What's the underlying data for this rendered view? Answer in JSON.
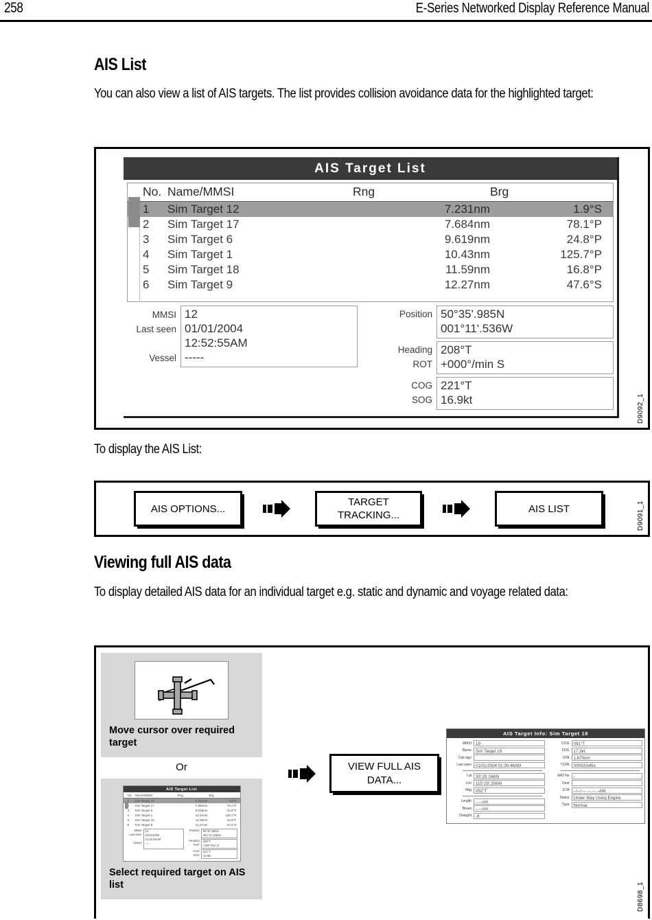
{
  "header": {
    "page_number": "258",
    "manual_title": "E-Series Networked Display Reference Manual"
  },
  "sections": {
    "ais_list": {
      "heading": "AIS List",
      "intro": "You can also view a list of AIS targets. The list provides collision avoidance data for the highlighted target:",
      "display_line": "To display the AIS List:"
    },
    "viewing_full": {
      "heading": "Viewing full AIS data",
      "intro": "To display detailed AIS data for an individual target e.g. static and dynamic and voyage related data:"
    }
  },
  "ais_list_screen": {
    "title": "AIS Target List",
    "columns": [
      "No.",
      "Name/MMSI",
      "Rng",
      "Brg"
    ],
    "rows": [
      {
        "no": "1",
        "name": "Sim Target 12",
        "rng": "7.231nm",
        "brg": "1.9°S",
        "selected": true
      },
      {
        "no": "2",
        "name": "Sim Target 17",
        "rng": "7.684nm",
        "brg": "78.1°P",
        "selected": false
      },
      {
        "no": "3",
        "name": "Sim Target 6",
        "rng": "9.619nm",
        "brg": "24.8°P",
        "selected": false
      },
      {
        "no": "4",
        "name": "Sim Target 1",
        "rng": "10.43nm",
        "brg": "125.7°P",
        "selected": false
      },
      {
        "no": "5",
        "name": "Sim Target 18",
        "rng": "11.59nm",
        "brg": "16.8°P",
        "selected": false
      },
      {
        "no": "6",
        "name": "Sim Target 9",
        "rng": "12.27nm",
        "brg": "47.6°S",
        "selected": false
      }
    ],
    "detail": {
      "labels_left": [
        "MMSI",
        "Last seen",
        "Vessel"
      ],
      "vessel_lines": [
        "12",
        "01/01/2004",
        "12:52:55AM",
        "-----"
      ],
      "position_label": "Position",
      "position_lines": [
        "50°35'.985N",
        "001°11'.536W"
      ],
      "heading_label": "Heading",
      "rot_label": "ROT",
      "heading_lines": [
        "208°T",
        "+000°/min S"
      ],
      "cog_label": "COG",
      "sog_label": "SOG",
      "cog_lines": [
        "221°T",
        "16.9kt"
      ]
    },
    "figure_ref": "D9092_1"
  },
  "flow_diagram": {
    "steps": [
      "AIS OPTIONS...",
      "TARGET TRACKING...",
      "AIS LIST"
    ],
    "figure_ref": "D9091_1"
  },
  "view_data_diagram": {
    "cursor_caption": "Move cursor over required target",
    "or_label": "Or",
    "list_caption": "Select required target on AIS list",
    "button_label": "VIEW FULL AIS DATA...",
    "figure_ref": "D8698_1",
    "mini_list": {
      "title": "AIS Target List",
      "columns": [
        "No.",
        "Name/MMSI",
        "Rng",
        "Brg"
      ],
      "rows": [
        {
          "no": "1",
          "name": "Sim Target 12",
          "rng": "7.231nm",
          "brg": "1.9°S",
          "selected": true
        },
        {
          "no": "2",
          "name": "Sim Target 17",
          "rng": "7.684nm",
          "brg": "78.1°P",
          "selected": false
        },
        {
          "no": "3",
          "name": "Sim Target 6",
          "rng": "9.619nm",
          "brg": "24.8°P",
          "selected": false
        },
        {
          "no": "4",
          "name": "Sim Target 1",
          "rng": "10.43nm",
          "brg": "125.7°P",
          "selected": false
        },
        {
          "no": "5",
          "name": "Sim Target 18",
          "rng": "11.59nm",
          "brg": "16.8°P",
          "selected": false
        },
        {
          "no": "6",
          "name": "Sim Target 9",
          "rng": "12.27nm",
          "brg": "47.6°S",
          "selected": false
        }
      ],
      "detail": {
        "mmsi_label": "MMSI",
        "last_seen_label": "Last seen",
        "vessel_label": "Vessel",
        "vessel_lines": [
          "12",
          "01/01/2004",
          "12:52:55AM",
          "-----"
        ],
        "position_label": "Position",
        "position_lines": [
          "50°35'.985N",
          "001°11'.536W"
        ],
        "heading_label": "Heading",
        "rot_label": "ROT",
        "heading_lines": [
          "208°T",
          "+000°/min S"
        ],
        "cog_label": "COG",
        "sog_label": "SOG",
        "cog_lines": [
          "221°T",
          "16.9kt"
        ]
      }
    },
    "target_info": {
      "title": "AIS Target Info: Sim Target 19",
      "left_fields": [
        {
          "label": "MMSI",
          "value": "19"
        },
        {
          "label": "Name",
          "value": "Sim Target 19"
        },
        {
          "label": "Call sign",
          "value": ""
        },
        {
          "label": "Last seen",
          "value": "01/01/2004 01:30:48AM"
        }
      ],
      "left_fields_2": [
        {
          "label": "Lat",
          "value": "35°25'.568N"
        },
        {
          "label": "Lon",
          "value": "115°29'.256W"
        },
        {
          "label": "Hdg",
          "value": "052°T"
        }
      ],
      "left_fields_3": [
        {
          "label": "Length",
          "value": "-.---nm"
        },
        {
          "label": "Beam",
          "value": "-.---nm"
        },
        {
          "label": "Draught",
          "value": "-ft"
        }
      ],
      "right_fields": [
        {
          "label": "COG",
          "value": "091°T"
        },
        {
          "label": "SOG",
          "value": "17.3kt"
        },
        {
          "label": "CPA",
          "value": "1.670nm"
        },
        {
          "label": "TCPA",
          "value": "00h02m45s"
        }
      ],
      "right_fields_2": [
        {
          "label": "IMO No",
          "value": "-"
        },
        {
          "label": "Dest",
          "value": ""
        },
        {
          "label": "ETA",
          "value": "--/--/---- --:--:--AM"
        },
        {
          "label": "Status",
          "value": "Under Way Using Engine"
        },
        {
          "label": "Type",
          "value": "Normal"
        }
      ]
    }
  }
}
